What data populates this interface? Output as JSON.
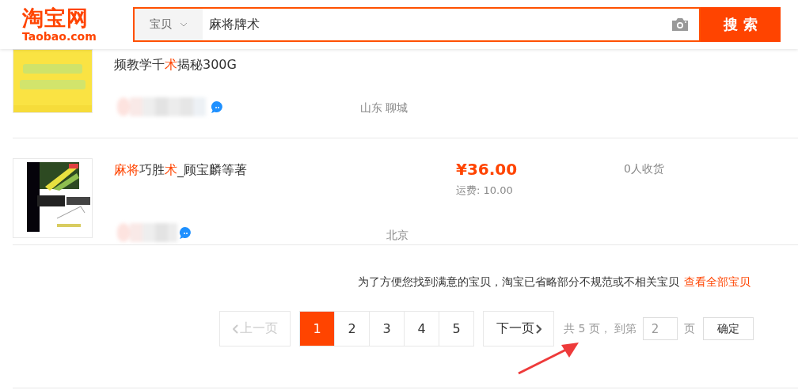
{
  "header": {
    "logo": {
      "title": "淘宝网",
      "subtitle": "Taobao.com"
    },
    "search": {
      "category": "宝贝",
      "value": "麻将牌术",
      "button": "搜 索"
    }
  },
  "items": [
    {
      "title": [
        {
          "text": "频教学千",
          "highlight": false
        },
        {
          "text": "术",
          "highlight": true
        },
        {
          "text": "揭秘300G",
          "highlight": false
        }
      ],
      "location": "山东 聊城",
      "cut": true
    },
    {
      "title": [
        {
          "text": "麻将",
          "highlight": true
        },
        {
          "text": "巧胜",
          "highlight": false
        },
        {
          "text": "术",
          "highlight": true
        },
        {
          "text": "_顾宝麟等著",
          "highlight": false
        }
      ],
      "price": "¥36.00",
      "shipping": "运费: 10.00",
      "sales": "0人收货",
      "location": "北京",
      "cut": false
    }
  ],
  "notice": {
    "text": "为了方便您找到满意的宝贝，淘宝已省略部分不规范或不相关宝贝",
    "link": "查看全部宝贝"
  },
  "pagination": {
    "prev": {
      "label": "上一页",
      "disabled": true
    },
    "pages": [
      {
        "label": "1",
        "selected": true
      },
      {
        "label": "2",
        "selected": false
      },
      {
        "label": "3",
        "selected": false
      },
      {
        "label": "4",
        "selected": false
      },
      {
        "label": "5",
        "selected": false
      }
    ],
    "next": {
      "label": "下一页",
      "disabled": false
    },
    "total": "共 5 页，",
    "goto": "到第",
    "page_input": "2",
    "page_unit": "页",
    "confirm": "确定"
  }
}
